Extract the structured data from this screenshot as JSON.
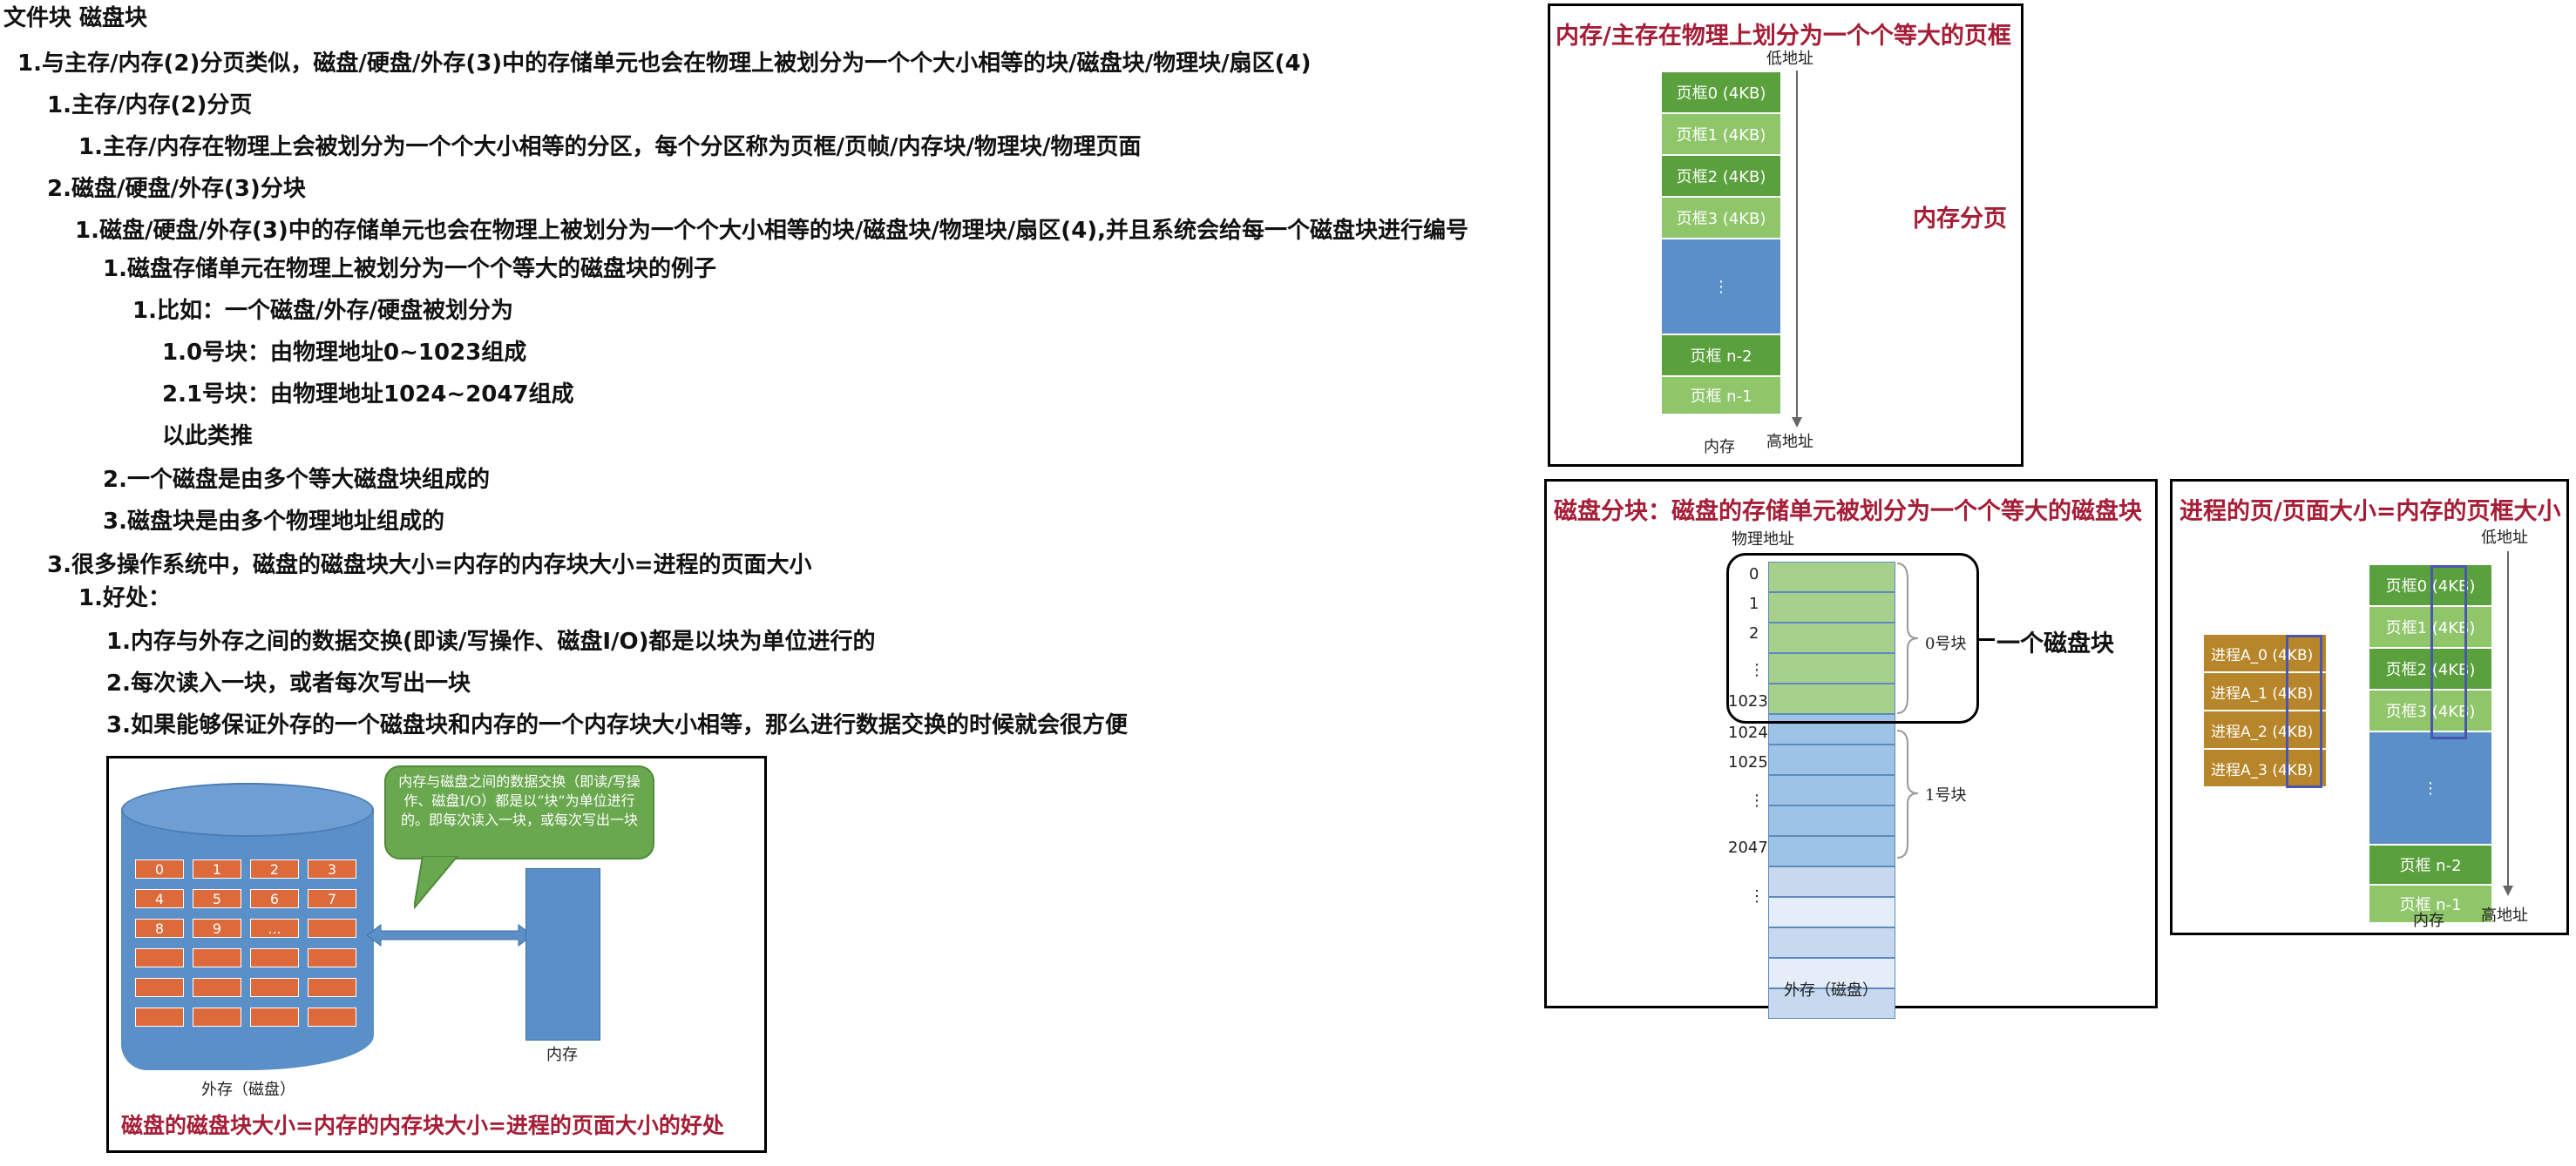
{
  "outline": {
    "title": "文件块 磁盘块",
    "lines": [
      "1.与主存/内存(2)分页类似，磁盘/硬盘/外存(3)中的存储单元也会在物理上被划分为一个个大小相等的块/磁盘块/物理块/扇区(4)",
      "1.主存/内存(2)分页",
      "1.主存/内存在物理上会被划分为一个个大小相等的分区，每个分区称为页框/页帧/内存块/物理块/物理页面",
      "2.磁盘/硬盘/外存(3)分块",
      "1.磁盘/硬盘/外存(3)中的存储单元也会在物理上被划分为一个个大小相等的块/磁盘块/物理块/扇区(4),并且系统会给每一个磁盘块进行编号",
      "1.磁盘存储单元在物理上被划分为一个个等大的磁盘块的例子",
      "1.比如：一个磁盘/外存/硬盘被划分为",
      "1.0号块：由物理地址0~1023组成",
      "2.1号块：由物理地址1024~2047组成",
      "以此类推",
      "2.一个磁盘是由多个等大磁盘块组成的",
      "3.磁盘块是由多个物理地址组成的",
      "3.很多操作系统中，磁盘的磁盘块大小=内存的内存块大小=进程的页面大小",
      "1.好处：",
      "1.内存与外存之间的数据交换(即读/写操作、磁盘I/O)都是以块为单位进行的",
      "2.每次读入一块，或者每次写出一块",
      "3.如果能够保证外存的一个磁盘块和内存的一个内存块大小相等，那么进行数据交换的时候就会很方便"
    ]
  },
  "fig_exchange": {
    "caption": "磁盘的磁盘块大小=内存的内存块大小=进程的页面大小的好处",
    "bubble": "内存与磁盘之间的数据交换（即读/写操作、磁盘I/O）都是以“块”为单位进行的。即每次读入一块，或每次写出一块",
    "disk_label": "外存（磁盘）",
    "mem_label": "内存",
    "blocks": [
      "0",
      "1",
      "2",
      "3",
      "4",
      "5",
      "6",
      "7",
      "8",
      "9",
      "...",
      "",
      "",
      "",
      "",
      "",
      "",
      "",
      "",
      "",
      "",
      "",
      "",
      ""
    ]
  },
  "fig_memory": {
    "title": "内存/主存在物理上划分为一个个等大的页框",
    "side_label": "内存分页",
    "low_addr": "低地址",
    "high_addr": "高地址",
    "mem_label": "内存",
    "frames": [
      "页框0 (4KB)",
      "页框1 (4KB)",
      "页框2 (4KB)",
      "页框3 (4KB)",
      "⋮",
      "页框 n-2",
      "页框 n-1"
    ]
  },
  "fig_disk": {
    "title": "磁盘分块：磁盘的存储单元被划分为一个个等大的磁盘块",
    "phys_addr": "物理地址",
    "addr_labels_block0": [
      "0",
      "1",
      "2",
      "⋮",
      "1023"
    ],
    "addr_labels_block1": [
      "1024",
      "1025",
      "⋮",
      "2047"
    ],
    "addr_tail": "⋮",
    "block0_label": "0号块",
    "block1_label": "1号块",
    "one_block_label": "一个磁盘块",
    "disk_label": "外存（磁盘）"
  },
  "fig_process": {
    "title": "进程的页/页面大小=内存的页框大小",
    "low_addr": "低地址",
    "high_addr": "高地址",
    "mem_label": "内存",
    "pages": [
      "进程A_0 (4KB)",
      "进程A_1 (4KB)",
      "进程A_2 (4KB)",
      "进程A_3 (4KB)"
    ],
    "frames": [
      "页框0 (4KB)",
      "页框1 (4KB)",
      "页框2 (4KB)",
      "页框3 (4KB)",
      "⋮",
      "页框 n-2",
      "页框 n-1"
    ]
  }
}
